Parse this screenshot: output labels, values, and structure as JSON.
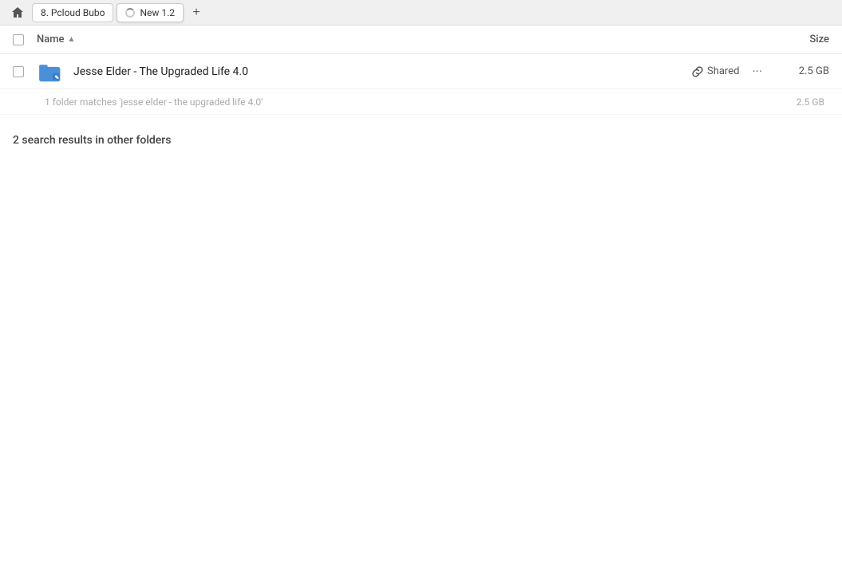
{
  "tabs": {
    "home_label": "8. Pcloud Bubo",
    "active_tab_label": "New 1.2",
    "add_button_label": "+"
  },
  "column_header": {
    "checkbox_label": "",
    "name_label": "Name",
    "sort_arrow": "▲",
    "size_label": "Size"
  },
  "file_entry": {
    "name": "Jesse Elder - The Upgraded Life 4.0",
    "shared_label": "Shared",
    "size": "2.5 GB",
    "more_label": "···"
  },
  "match_info": {
    "text": "1 folder matches 'jesse elder - the upgraded life 4.0'",
    "size": "2.5 GB"
  },
  "other_folders": {
    "label": "2 search results in other folders"
  },
  "icons": {
    "link_icon": "🔗",
    "folder_icon": "folder",
    "home_icon": "home"
  }
}
